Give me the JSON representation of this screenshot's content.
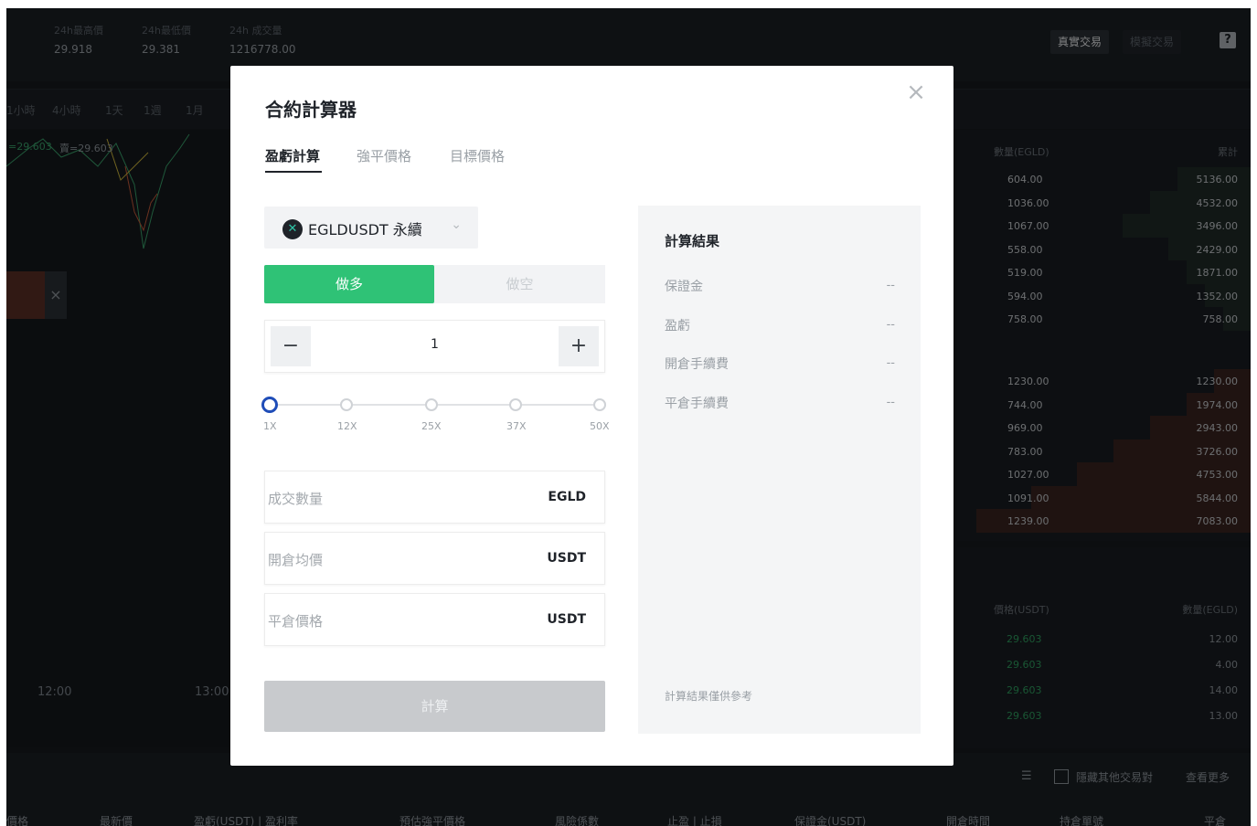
{
  "background": {
    "stats": [
      {
        "label": "24h最高價",
        "value": "29.918"
      },
      {
        "label": "24h最低價",
        "value": "29.381"
      },
      {
        "label": "24h 成交量",
        "value": "1216778.00"
      }
    ],
    "real_trade": "真實交易",
    "demo_trade": "模擬交易",
    "help": "?",
    "timeframes": [
      "1小時",
      "4小時",
      "1天",
      "1週",
      "1月"
    ],
    "chart_label_buy": "=29.603",
    "chart_label_sell": "賣=29.603",
    "close_x": "×",
    "time_labels": [
      "12:00",
      "13:00"
    ],
    "book_head": {
      "qty": "數量(EGLD)",
      "total": "累計"
    },
    "asks": [
      {
        "qty": "604.00",
        "total": "5136.00"
      },
      {
        "qty": "1036.00",
        "total": "4532.00"
      },
      {
        "qty": "1067.00",
        "total": "3496.00"
      },
      {
        "qty": "558.00",
        "total": "2429.00"
      },
      {
        "qty": "519.00",
        "total": "1871.00"
      },
      {
        "qty": "594.00",
        "total": "1352.00"
      },
      {
        "qty": "758.00",
        "total": "758.00"
      }
    ],
    "bids": [
      {
        "qty": "1230.00",
        "total": "1230.00"
      },
      {
        "qty": "744.00",
        "total": "1974.00"
      },
      {
        "qty": "969.00",
        "total": "2943.00"
      },
      {
        "qty": "783.00",
        "total": "3726.00"
      },
      {
        "qty": "1027.00",
        "total": "4753.00"
      },
      {
        "qty": "1091.00",
        "total": "5844.00"
      },
      {
        "qty": "1239.00",
        "total": "7083.00"
      }
    ],
    "trades_head": {
      "price": "價格(USDT)",
      "qty": "數量(EGLD)"
    },
    "trades": [
      {
        "price": "29.603",
        "qty": "12.00"
      },
      {
        "price": "29.603",
        "qty": "4.00"
      },
      {
        "price": "29.603",
        "qty": "14.00"
      },
      {
        "price": "29.603",
        "qty": "13.00"
      }
    ],
    "bottom_tools": {
      "hide_label": "隱藏其他交易對",
      "view_more": "查看更多"
    },
    "bottom_cols": [
      "價格",
      "最新價",
      "盈虧(USDT) | 盈利率",
      "預估強平價格",
      "風險係數",
      "止盈 | 止損",
      "保證金(USDT)",
      "開倉時間",
      "持倉單號",
      "平倉"
    ]
  },
  "modal": {
    "title": "合約計算器",
    "close": "×",
    "tabs": [
      {
        "label": "盈虧計算"
      },
      {
        "label": "強平價格"
      },
      {
        "label": "目標價格"
      }
    ],
    "symbol": {
      "logo": "✕",
      "name": "EGLDUSDT 永續",
      "chevron": "⌄"
    },
    "side": {
      "long": "做多",
      "short": "做空"
    },
    "leverage": {
      "minus": "−",
      "plus": "+",
      "value": "1",
      "marks": [
        "1X",
        "12X",
        "25X",
        "37X",
        "50X"
      ],
      "selected_index": 0
    },
    "fields": [
      {
        "placeholder": "成交數量",
        "unit": "EGLD"
      },
      {
        "placeholder": "開倉均價",
        "unit": "USDT"
      },
      {
        "placeholder": "平倉價格",
        "unit": "USDT"
      }
    ],
    "calc_button": "計算",
    "result": {
      "title": "計算結果",
      "rows": [
        {
          "label": "保證金",
          "value": "--"
        },
        {
          "label": "盈虧",
          "value": "--"
        },
        {
          "label": "開倉手續費",
          "value": "--"
        },
        {
          "label": "平倉手續費",
          "value": "--"
        }
      ],
      "note": "計算結果僅供參考"
    }
  }
}
